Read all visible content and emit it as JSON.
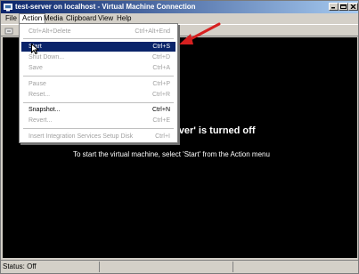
{
  "window": {
    "title": "test-server on localhost - Virtual Machine Connection"
  },
  "menubar": {
    "items": [
      "File",
      "Action",
      "Media",
      "Clipboard",
      "View",
      "Help"
    ],
    "active": "Action"
  },
  "action_menu": {
    "groups": [
      [
        {
          "label": "Ctrl+Alt+Delete",
          "shortcut": "Ctrl+Alt+End",
          "enabled": false
        }
      ],
      [
        {
          "label": "Start",
          "shortcut": "Ctrl+S",
          "enabled": true,
          "highlighted": true
        },
        {
          "label": "Shut Down...",
          "shortcut": "Ctrl+D",
          "enabled": false
        },
        {
          "label": "Save",
          "shortcut": "Ctrl+A",
          "enabled": false
        }
      ],
      [
        {
          "label": "Pause",
          "shortcut": "Ctrl+P",
          "enabled": false
        },
        {
          "label": "Reset...",
          "shortcut": "Ctrl+R",
          "enabled": false
        }
      ],
      [
        {
          "label": "Snapshot...",
          "shortcut": "Ctrl+N",
          "enabled": true
        },
        {
          "label": "Revert...",
          "shortcut": "Ctrl+E",
          "enabled": false
        }
      ],
      [
        {
          "label": "Insert Integration Services Setup Disk",
          "shortcut": "Ctrl+I",
          "enabled": false
        }
      ]
    ]
  },
  "vm_display": {
    "title": "test-server' is turned off",
    "subtitle": "To start the virtual machine, select 'Start' from the Action menu"
  },
  "statusbar": {
    "status": "Status: Off"
  },
  "colors": {
    "highlight": "#0a246a",
    "annotation_arrow": "#d62020",
    "disabled_text": "#a0a0a0"
  }
}
